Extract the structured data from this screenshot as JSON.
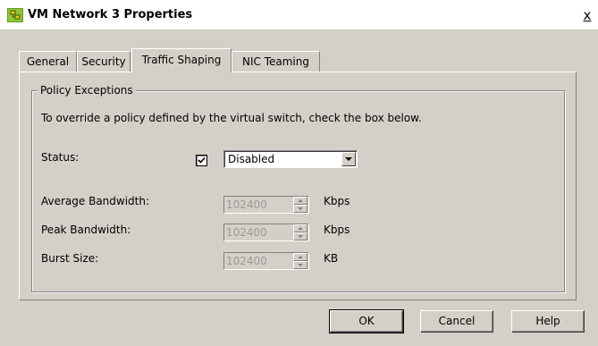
{
  "window": {
    "title": "VM Network 3 Properties",
    "close_label": "x"
  },
  "tabs": [
    {
      "label": "General"
    },
    {
      "label": "Security"
    },
    {
      "label": "Traffic Shaping"
    },
    {
      "label": "NIC Teaming"
    }
  ],
  "active_tab": "Traffic Shaping",
  "group": {
    "legend": "Policy Exceptions",
    "description": "To override a policy defined by the virtual switch, check the box below."
  },
  "status": {
    "label": "Status:",
    "checked": true,
    "selected": "Disabled"
  },
  "fields": [
    {
      "label": "Average Bandwidth:",
      "value": "102400",
      "unit": "Kbps"
    },
    {
      "label": "Peak Bandwidth:",
      "value": "102400",
      "unit": "Kbps"
    },
    {
      "label": "Burst Size:",
      "value": "102400",
      "unit": "KB"
    }
  ],
  "buttons": {
    "ok": "OK",
    "cancel": "Cancel",
    "help": "Help"
  },
  "colors": {
    "dialog_bg": "#d4d0c8",
    "titlebar_bg": "#ffffff",
    "disabled_text": "#9a9a9a"
  },
  "icons": {
    "title": "vm-network-icon",
    "close": "close-icon",
    "dropdown": "chevron-down-icon",
    "spin_up": "spin-up-icon",
    "spin_down": "spin-down-icon"
  }
}
